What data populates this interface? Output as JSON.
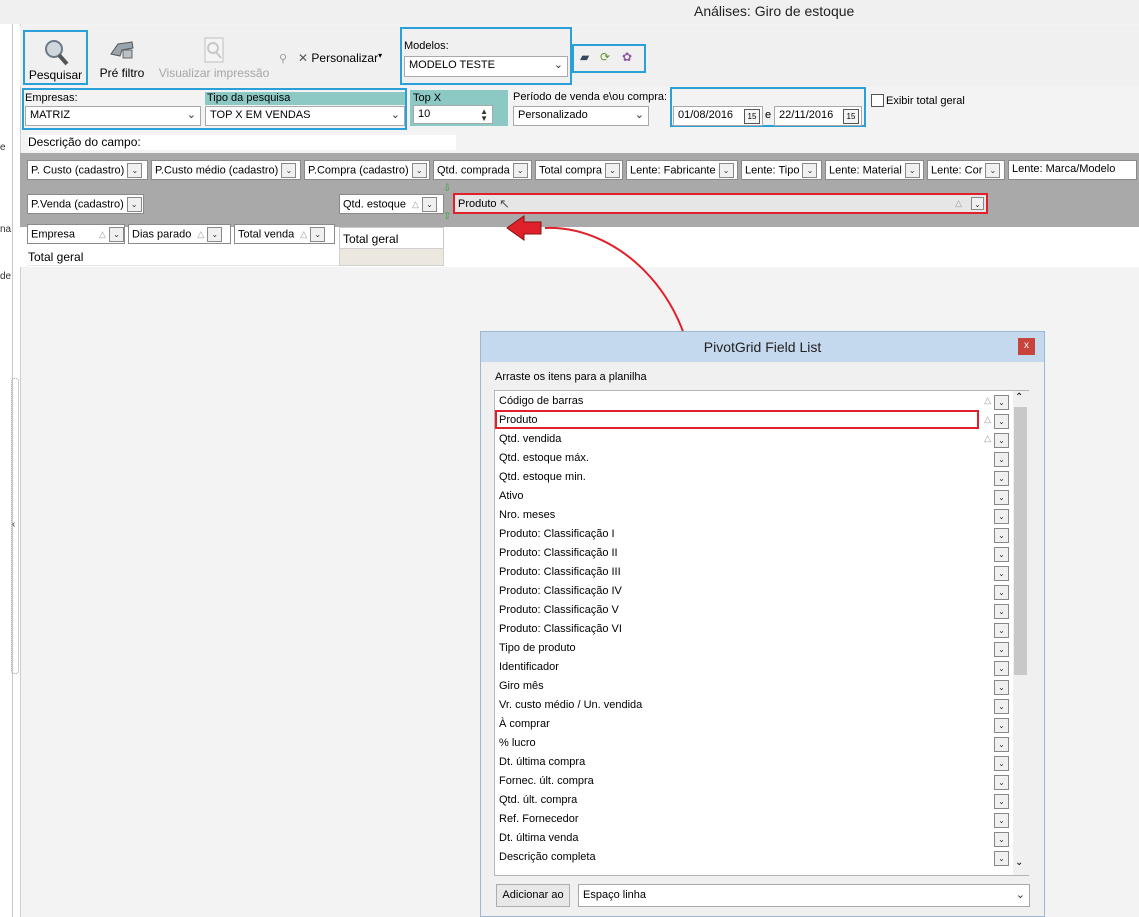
{
  "window": {
    "title": "Análises: Giro de estoque"
  },
  "left_strip_fragments": [
    "e",
    "na",
    "de"
  ],
  "toolbar": {
    "pesquisar": "Pesquisar",
    "pre_filtro": "Pré filtro",
    "visualizar": "Visualizar impressão",
    "personalizar": "Personalizar",
    "modelos_label": "Modelos:",
    "modelos_value": "MODELO TESTE"
  },
  "filters": {
    "empresas_label": "Empresas:",
    "empresas_value": "MATRIZ",
    "tipo_label": "Tipo da pesquisa",
    "tipo_value": "TOP X EM VENDAS",
    "topx_label": "Top X",
    "topx_value": "10",
    "periodo_label": "Período de venda e\\ou compra:",
    "periodo_value": "Personalizado",
    "date_from": "01/08/2016",
    "date_sep": "e",
    "date_to": "22/11/2016",
    "exibir_total": "Exibir total geral",
    "descricao_label": "Descrição do campo:"
  },
  "pivot": {
    "filter_fields": [
      "P. Custo (cadastro)",
      "P.Custo médio (cadastro)",
      "P.Compra (cadastro)",
      "Qtd. comprada",
      "Total compra",
      "Lente: Fabricante",
      "Lente: Tipo",
      "Lente: Material",
      "Lente: Cor",
      "Lente: Marca/Modelo"
    ],
    "column_field_left": "P.Venda (cadastro)",
    "data_field": "Qtd. estoque",
    "dragging_field": "Produto",
    "row_fields": [
      "Empresa",
      "Dias parado",
      "Total venda"
    ],
    "total_geral_col": "Total geral",
    "total_geral_row": "Total geral"
  },
  "field_list": {
    "title": "PivotGrid Field List",
    "close": "x",
    "instruction": "Arraste os itens para a planilha",
    "items": [
      "Código de barras",
      "Produto",
      "Qtd. vendida",
      "Qtd. estoque máx.",
      "Qtd. estoque min.",
      "Ativo",
      "Nro. meses",
      "Produto: Classificação I",
      "Produto: Classificação II",
      "Produto: Classificação III",
      "Produto: Classificação IV",
      "Produto: Classificação V",
      "Produto: Classificação VI",
      "Tipo de produto",
      "Identificador",
      "Giro mês",
      "Vr. custo médio / Un. vendida",
      "À comprar",
      "% lucro",
      "Dt. última compra",
      "Fornec. últ. compra",
      "Qtd. últ. compra",
      "Ref. Fornecedor",
      "Dt. última venda",
      "Descrição completa"
    ],
    "add_button": "Adicionar ao",
    "target_value": "Espaço linha"
  },
  "colors": {
    "highlight_blue": "#2a9fd8",
    "annotation_red": "#e0202a",
    "teal_header": "#8cc9c4"
  }
}
